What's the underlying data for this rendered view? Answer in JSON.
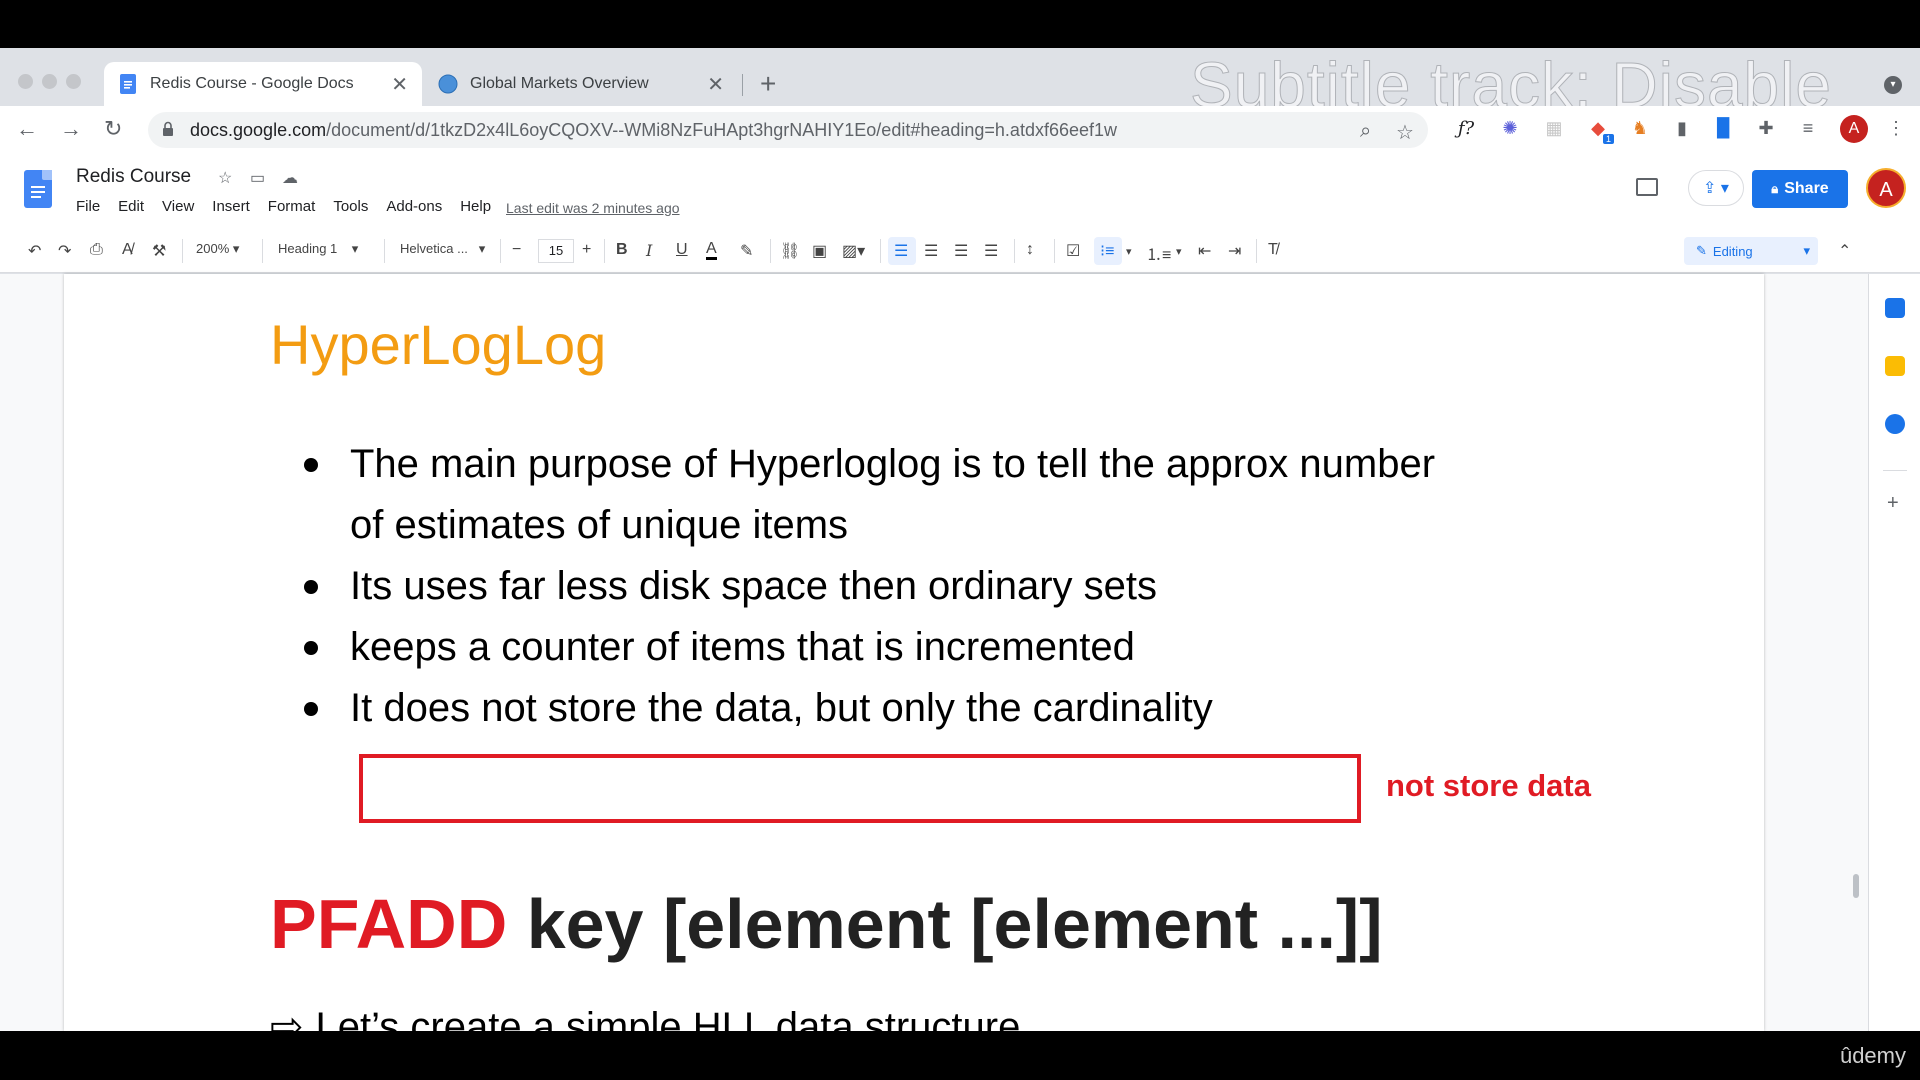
{
  "browser": {
    "tabs": [
      {
        "label": "Redis Course - Google Docs",
        "active": true
      },
      {
        "label": "Global Markets Overview",
        "active": false
      }
    ],
    "overlay_text": "Subtitle track: Disable",
    "url_host": "docs.google.com",
    "url_path": "/document/d/1tkzD2x4lL6oyCQOXV--WMi8NzFuHApt3hgrNAHIY1Eo/edit#heading=h.atdxf66eef1w",
    "profile_initial": "A",
    "extension_badge": "1"
  },
  "docs": {
    "title": "Redis Course",
    "menu": [
      "File",
      "Edit",
      "View",
      "Insert",
      "Format",
      "Tools",
      "Add-ons",
      "Help"
    ],
    "last_edit": "Last edit was 2 minutes ago",
    "share_label": "Share",
    "avatar_initial": "A"
  },
  "format_toolbar": {
    "zoom": "200%",
    "style": "Heading 1",
    "font": "Helvetica ...",
    "font_size": "15",
    "mode": "Editing"
  },
  "document": {
    "heading": "HyperLogLog",
    "bullets": [
      "The main purpose of Hyperloglog is to tell the approx number",
      "of estimates of unique items",
      "Its uses far less disk space then ordinary sets",
      "keeps a counter of items that is incremented",
      "It does not store the data, but only the cardinality"
    ],
    "annotation": "not store data",
    "command_keyword": "PFADD",
    "command_rest": " key [element [element ...]]",
    "subtext": "Let’s create a simple HLL data structure"
  },
  "watermark": "ûdemy",
  "colors": {
    "accent": "#1a73e8",
    "heading_orange": "#f39c12",
    "highlight_red": "#e01b24"
  }
}
